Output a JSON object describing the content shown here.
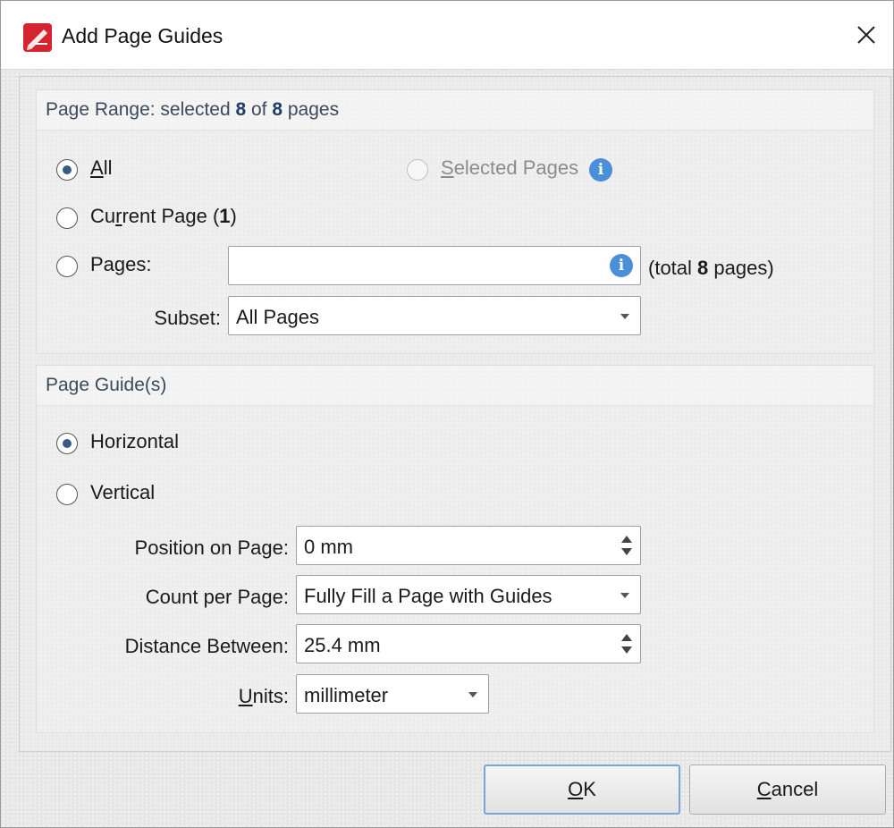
{
  "window": {
    "title": "Add Page Guides"
  },
  "page_range": {
    "header_prefix": "Page Range: selected ",
    "selected_count": "8",
    "header_of": " of ",
    "total_count": "8",
    "header_suffix": " pages",
    "options": {
      "all": {
        "label_u": "A",
        "label_rest": "ll",
        "checked": true
      },
      "selected_pages": {
        "label_u": "S",
        "label_rest": "elected Pages",
        "disabled": true
      },
      "current_page": {
        "label_pre": "Cu",
        "label_u": "r",
        "label_rest": "rent Page (",
        "page": "1",
        "label_end": ")"
      },
      "pages": {
        "label_pre": "Pa",
        "label_u": "g",
        "label_rest": "es:"
      }
    },
    "pages_input": {
      "value": ""
    },
    "total_prefix": "(total ",
    "total_pages": "8",
    "total_suffix": " pages)",
    "subset_label": "Subset:",
    "subset_value": "All Pages"
  },
  "page_guides": {
    "header": "Page Guide(s)",
    "horizontal_label": "Horizontal",
    "horizontal_checked": true,
    "vertical_label": "Vertical",
    "position_label": "Position on Page:",
    "position_value": "0 mm",
    "count_label": "Count per Page:",
    "count_value": "Fully Fill a Page with Guides",
    "distance_label": "Distance Between:",
    "distance_value": "25.4 mm",
    "units_label_u": "U",
    "units_label_rest": "nits:",
    "units_value": "millimeter"
  },
  "buttons": {
    "ok_u": "O",
    "ok_rest": "K",
    "cancel_u": "C",
    "cancel_rest": "ancel"
  },
  "colors": {
    "accent": "#3a5a85",
    "info": "#4a90d9",
    "default_button_border": "#7aa6d6"
  }
}
